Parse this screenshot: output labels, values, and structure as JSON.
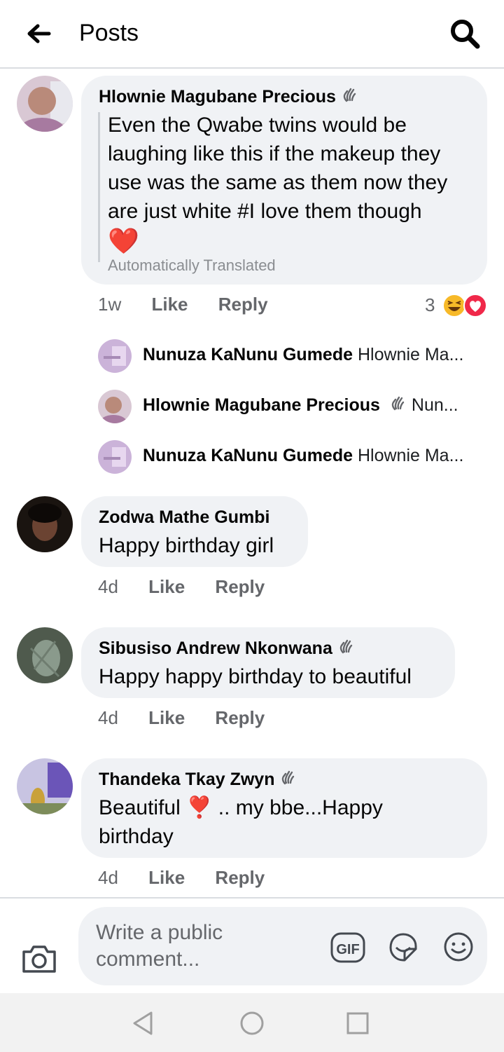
{
  "header": {
    "title": "Posts"
  },
  "comments": [
    {
      "author": "Hlownie Magubane Precious",
      "text": "Even the Qwabe twins would be laughing like this if the makeup they use was the same as them now they are just white #I love them though",
      "emoji": "❤️",
      "translated_label": "Automatically Translated",
      "time": "1w",
      "like": "Like",
      "reply": "Reply",
      "reaction_count": "3",
      "replies": [
        {
          "author": "Nunuza KaNunu Gumede",
          "preview": "Hlownie Ma..."
        },
        {
          "author": "Hlownie Magubane Precious",
          "preview": "Nun..."
        },
        {
          "author": "Nunuza KaNunu Gumede",
          "preview": "Hlownie Ma..."
        }
      ]
    },
    {
      "author": "Zodwa Mathe Gumbi",
      "text": "Happy birthday girl",
      "time": "4d",
      "like": "Like",
      "reply": "Reply"
    },
    {
      "author": "Sibusiso Andrew Nkonwana",
      "text": "Happy happy birthday to beautiful",
      "time": "4d",
      "like": "Like",
      "reply": "Reply"
    },
    {
      "author": "Thandeka Tkay Zwyn",
      "text_before": "Beautiful",
      "emoji": "❣️",
      "text_after": ".. my bbe...Happy birthday",
      "time": "4d",
      "like": "Like",
      "reply": "Reply"
    }
  ],
  "composer": {
    "placeholder": "Write a public comment..."
  },
  "icons": [
    "back-arrow-icon",
    "search-icon",
    "wave-hand-icon",
    "haha-reaction-icon",
    "love-reaction-icon",
    "camera-icon",
    "gif-icon",
    "sticker-icon",
    "emoji-icon",
    "nav-back-icon",
    "nav-home-icon",
    "nav-recents-icon"
  ],
  "colors": {
    "bubble": "#f0f2f5",
    "meta": "#65676b",
    "heart": "#f02849",
    "haha": "#f7b928"
  }
}
